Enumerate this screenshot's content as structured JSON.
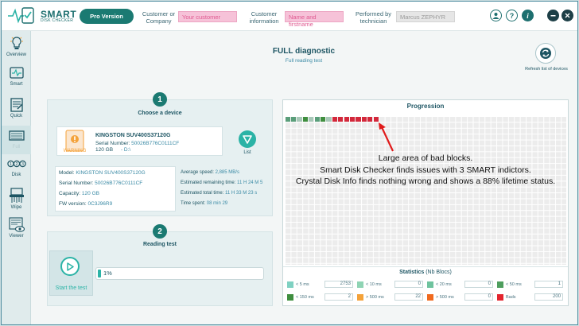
{
  "app": {
    "logo_line1": "SMART",
    "logo_line2": "DISK CHECKER",
    "pro_button": "Pro Version"
  },
  "header": {
    "customer_label": "Customer or Company",
    "customer_placeholder": "Your customer",
    "info_label": "Customer information",
    "info_placeholder": "Name and firstname",
    "tech_label": "Performed by technician",
    "tech_value": "Marcus ZEPHYR"
  },
  "sidebar": {
    "items": [
      {
        "label": "Overview",
        "icon": "lightbulb-icon"
      },
      {
        "label": "Smart",
        "icon": "smart-icon"
      },
      {
        "label": "Quick",
        "icon": "quick-icon"
      },
      {
        "label": "Full",
        "icon": "full-icon"
      },
      {
        "label": "Disk",
        "icon": "disk-icon"
      },
      {
        "label": "Wipe",
        "icon": "wipe-icon"
      },
      {
        "label": "Viewer",
        "icon": "viewer-icon"
      }
    ]
  },
  "page": {
    "title": "FULL diagnostic",
    "subtitle": "Full reading test",
    "refresh_label": "Refresh list of devices"
  },
  "step1": {
    "number": "1",
    "title": "Choose a device",
    "warning": "WARNING",
    "device_name": "KINGSTON SUV400S37120G",
    "serial_label": "Serial Number:",
    "serial_value": "50026B776C0111CF",
    "capacity": "120 GB",
    "drive": "- D:\\",
    "list_label": "List"
  },
  "info": {
    "model_label": "Model:",
    "model_value": "KINGSTON SUV400S37120G",
    "serial_label": "Serial Number:",
    "serial_value": "50026B776C0111CF",
    "capacity_label": "Capacity:",
    "capacity_value": "120 GB",
    "fw_label": "FW version:",
    "fw_value": "0C3J96R9",
    "speed_label": "Average speed:",
    "speed_value": "2,885 MB/s",
    "remaining_label": "Estimated remaining time:",
    "remaining_value": "11 H 24 M 5",
    "total_label": "Estimated total time:",
    "total_value": "11 H 33 M 23 s",
    "spent_label": "Time spent:",
    "spent_value": "08 min 29"
  },
  "step2": {
    "number": "2",
    "title": "Reading test",
    "start_label": "Start the test",
    "progress_label": "1%",
    "progress_fraction": 0.01
  },
  "progression": {
    "title": "Progression",
    "blocks": [
      "#5a9e7a",
      "#5a9e7a",
      "#a8c8b8",
      "#3f8e3f",
      "#a8c8b8",
      "#5a9e7a",
      "#3f8e3f",
      "#a8c8b8",
      "#d3283b",
      "#d3283b",
      "#d3283b",
      "#d3283b",
      "#d3283b",
      "#d3283b",
      "#d3283b",
      "#d3283b"
    ]
  },
  "annotation": {
    "line1": "Large area of bad blocks.",
    "line2": "Smart Disk Checker finds issues with 3 SMART indictors.",
    "line3": "Crystal Disk Info finds nothing wrong and shows a 88% lifetime status."
  },
  "stats": {
    "title": "Statistics",
    "subtitle": "(Nb Blocs)",
    "items": [
      {
        "label": "< 5 ms",
        "value": "2753",
        "color": "#7fd1c2"
      },
      {
        "label": "< 10 ms",
        "value": "0",
        "color": "#8fd4b4"
      },
      {
        "label": "< 20 ms",
        "value": "0",
        "color": "#6fc39e"
      },
      {
        "label": "< 50 ms",
        "value": "1",
        "color": "#4e9e5e"
      },
      {
        "label": "< 150 ms",
        "value": "2",
        "color": "#3f8e3f"
      },
      {
        "label": "> 500 ms",
        "value": "22",
        "color": "#f4a23a"
      },
      {
        "label": "> 500 ms",
        "value": "0",
        "color": "#f06a1f"
      },
      {
        "label": "Bads",
        "value": "200",
        "color": "#e3252e"
      }
    ]
  },
  "colors": {
    "accent": "#1b7a72",
    "teal": "#2bb3a6",
    "bad": "#d3283b"
  }
}
